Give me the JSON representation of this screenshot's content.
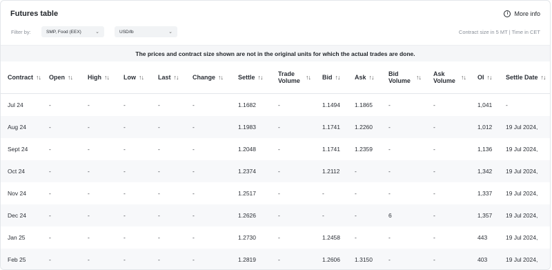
{
  "header": {
    "title": "Futures table",
    "more_info": "More info",
    "info_icon": "info-icon"
  },
  "filters": {
    "label": "Filter by:",
    "product": "SMP, Food (EEX)",
    "unit": "USD/lb"
  },
  "meta": "Contract size in 5 MT | Time in CET",
  "notice": "The prices and contract size shown are not in the original units for which the actual trades are done.",
  "columns": [
    {
      "label": "Contract"
    },
    {
      "label": "Open"
    },
    {
      "label": "High"
    },
    {
      "label": "Low"
    },
    {
      "label": "Last"
    },
    {
      "label": "Change"
    },
    {
      "label": "Settle"
    },
    {
      "label": "Trade Volume"
    },
    {
      "label": "Bid"
    },
    {
      "label": "Ask"
    },
    {
      "label": "Bid Volume"
    },
    {
      "label": "Ask Volume"
    },
    {
      "label": "OI"
    },
    {
      "label": "Settle Date"
    }
  ],
  "rows": [
    [
      "Jul 24",
      "-",
      "-",
      "-",
      "-",
      "-",
      "1.1682",
      "-",
      "1.1494",
      "1.1865",
      "-",
      "-",
      "1,041",
      "-"
    ],
    [
      "Aug 24",
      "-",
      "-",
      "-",
      "-",
      "-",
      "1.1983",
      "-",
      "1.1741",
      "1.2260",
      "-",
      "-",
      "1,012",
      "19 Jul 2024,"
    ],
    [
      "Sept 24",
      "-",
      "-",
      "-",
      "-",
      "-",
      "1.2048",
      "-",
      "1.1741",
      "1.2359",
      "-",
      "-",
      "1,136",
      "19 Jul 2024,"
    ],
    [
      "Oct 24",
      "-",
      "-",
      "-",
      "-",
      "-",
      "1.2374",
      "-",
      "1.2112",
      "-",
      "-",
      "-",
      "1,342",
      "19 Jul 2024,"
    ],
    [
      "Nov 24",
      "-",
      "-",
      "-",
      "-",
      "-",
      "1.2517",
      "-",
      "-",
      "-",
      "-",
      "-",
      "1,337",
      "19 Jul 2024,"
    ],
    [
      "Dec 24",
      "-",
      "-",
      "-",
      "-",
      "-",
      "1.2626",
      "-",
      "-",
      "-",
      "6",
      "-",
      "1,357",
      "19 Jul 2024,"
    ],
    [
      "Jan 25",
      "-",
      "-",
      "-",
      "-",
      "-",
      "1.2730",
      "-",
      "1.2458",
      "-",
      "-",
      "-",
      "443",
      "19 Jul 2024,"
    ],
    [
      "Feb 25",
      "-",
      "-",
      "-",
      "-",
      "-",
      "1.2819",
      "-",
      "1.2606",
      "1.3150",
      "-",
      "-",
      "403",
      "19 Jul 2024,"
    ]
  ]
}
